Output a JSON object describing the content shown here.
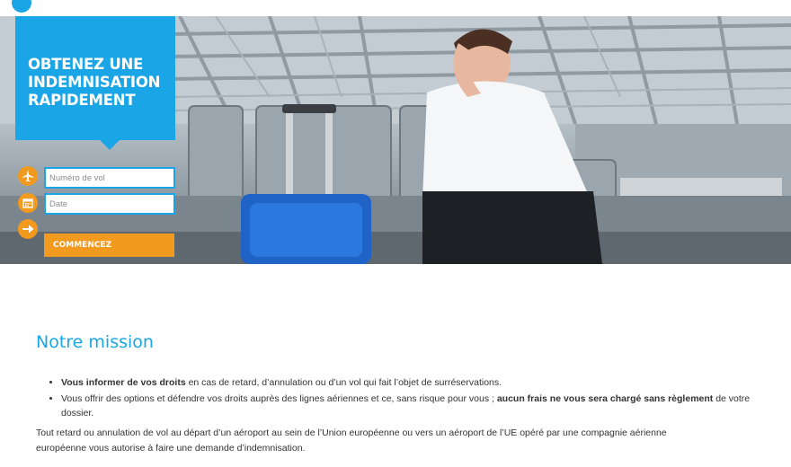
{
  "hero": {
    "title_lines": [
      "OBTENEZ UNE",
      "INDEMNISATION",
      "RAPIDEMENT"
    ],
    "form": {
      "flight_placeholder": "Numéro de vol",
      "date_placeholder": "Date",
      "start_label": "COMMENCEZ"
    },
    "icons": [
      "plane-icon",
      "calendar-icon",
      "arrow-right-icon"
    ]
  },
  "mission": {
    "title": "Notre mission",
    "item1_bold": "Vous informer de vos droits",
    "item1_rest": " en cas de retard, d’annulation ou d’un vol qui fait l’objet de surréservations.",
    "item2_start": "Vous offrir des options et défendre vos droits auprès des lignes aériennes et ce, sans risque pour vous ; ",
    "item2_bold": "aucun frais ne vous sera chargé sans règlement",
    "item2_end": " de votre dossier.",
    "paragraph": "Tout retard ou annulation de vol au départ d’un aéroport au sein de l’Union européenne ou vers un aéroport de l’UE opéré par une compagnie aérienne européenne vous autorise à faire une demande d’indemnisation."
  },
  "colors": {
    "brand_blue": "#1aa6e6",
    "accent_orange": "#f29a1e"
  }
}
